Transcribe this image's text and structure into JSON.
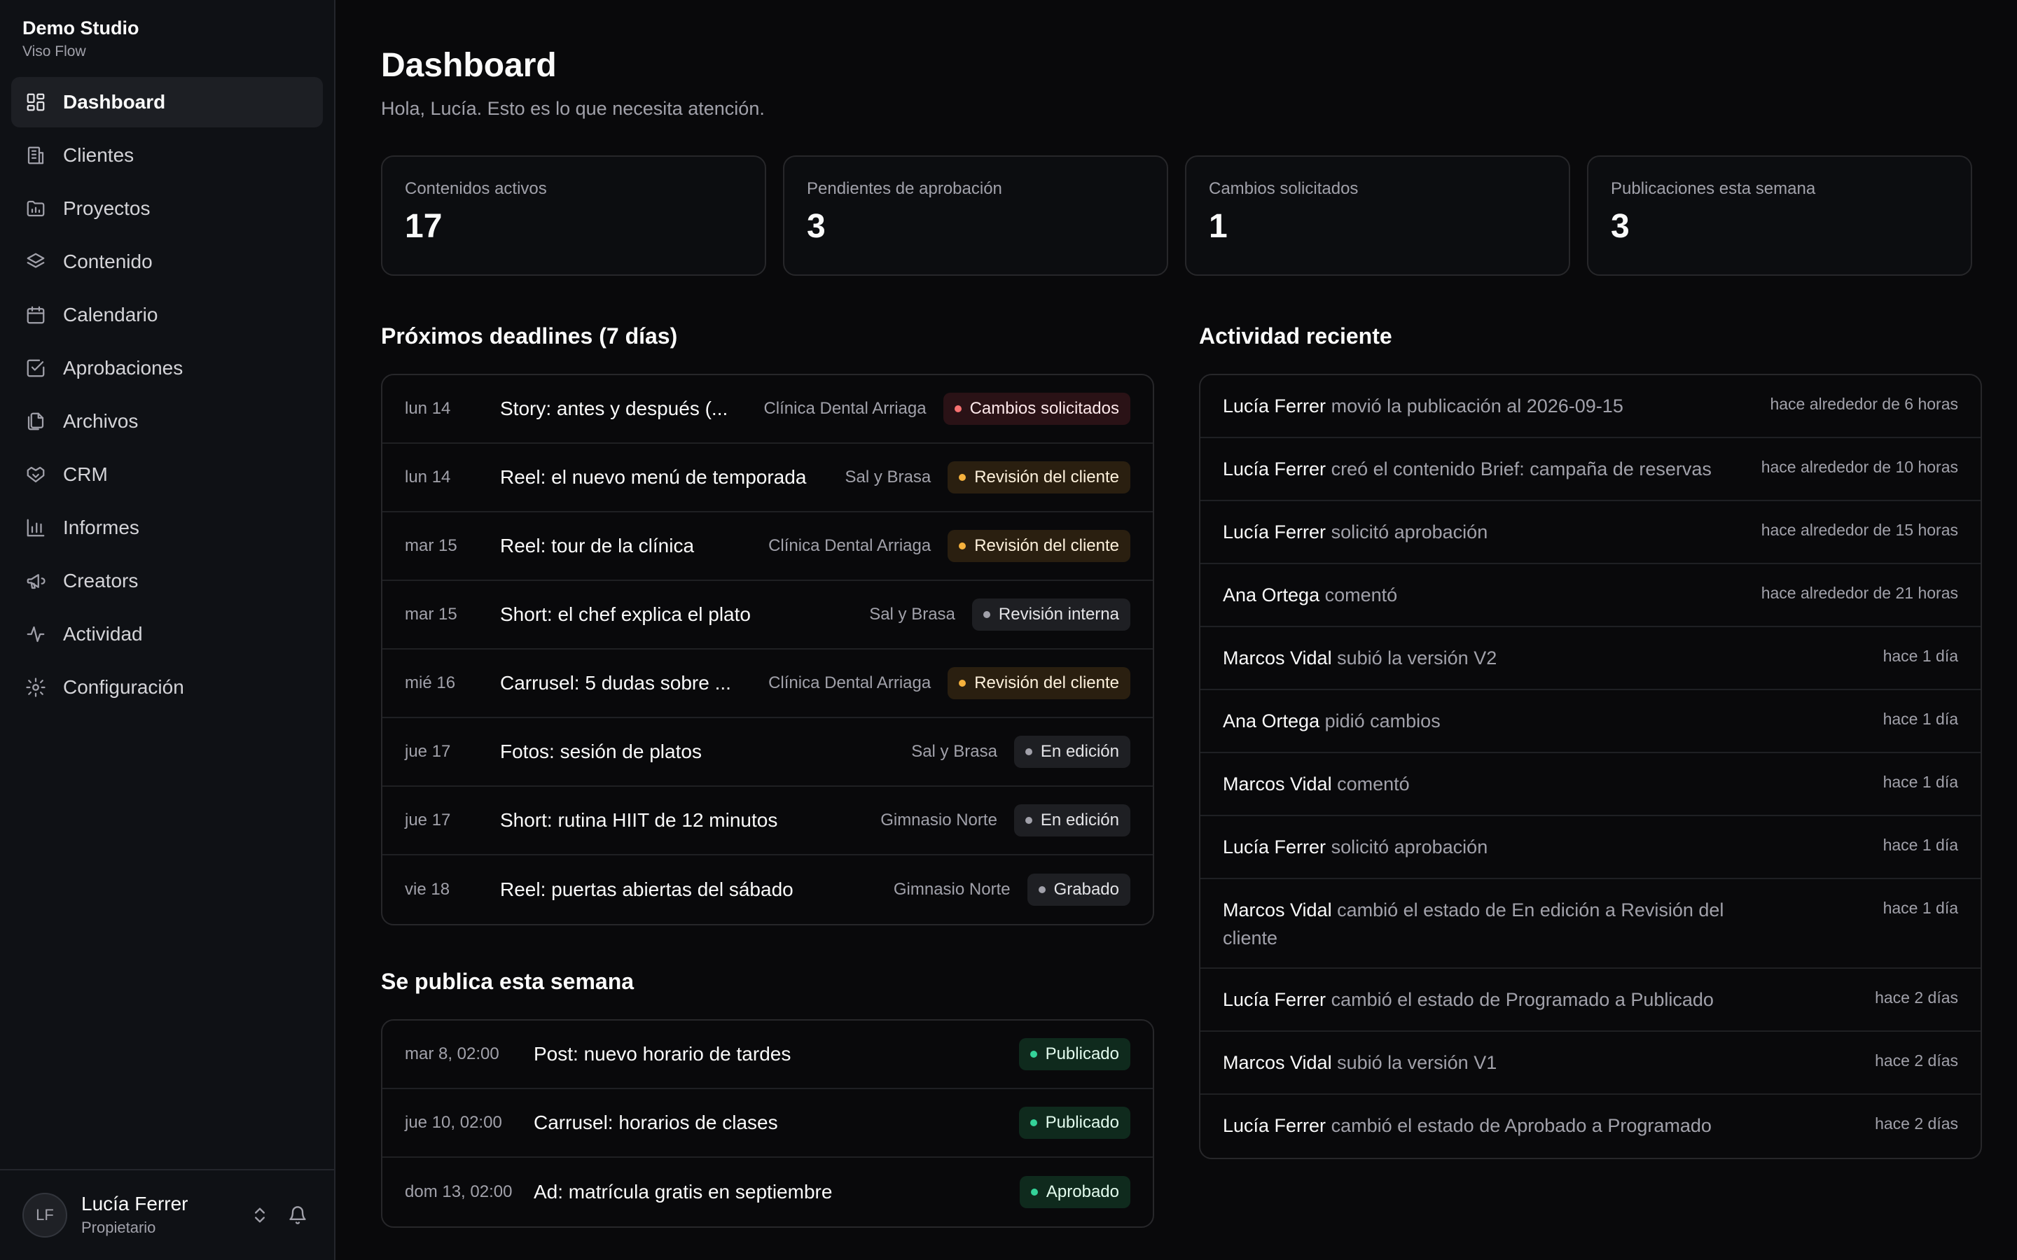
{
  "brand": {
    "name": "Demo Studio",
    "product": "Viso Flow"
  },
  "nav": [
    {
      "label": "Dashboard",
      "icon": "dashboard-icon",
      "active": true
    },
    {
      "label": "Clientes",
      "icon": "building-icon"
    },
    {
      "label": "Proyectos",
      "icon": "folder-chart-icon"
    },
    {
      "label": "Contenido",
      "icon": "layers-icon"
    },
    {
      "label": "Calendario",
      "icon": "calendar-icon"
    },
    {
      "label": "Aprobaciones",
      "icon": "check-square-icon"
    },
    {
      "label": "Archivos",
      "icon": "files-icon"
    },
    {
      "label": "CRM",
      "icon": "handshake-icon"
    },
    {
      "label": "Informes",
      "icon": "bar-chart-icon"
    },
    {
      "label": "Creators",
      "icon": "megaphone-icon"
    },
    {
      "label": "Actividad",
      "icon": "activity-icon"
    },
    {
      "label": "Configuración",
      "icon": "gear-icon"
    }
  ],
  "user": {
    "initials": "LF",
    "name": "Lucía Ferrer",
    "role": "Propietario"
  },
  "header": {
    "title": "Dashboard",
    "subtitle": "Hola, Lucía. Esto es lo que necesita atención."
  },
  "stats": [
    {
      "label": "Contenidos activos",
      "value": "17"
    },
    {
      "label": "Pendientes de aprobación",
      "value": "3"
    },
    {
      "label": "Cambios solicitados",
      "value": "1"
    },
    {
      "label": "Publicaciones esta semana",
      "value": "3"
    }
  ],
  "deadlines": {
    "title": "Próximos deadlines (7 días)",
    "rows": [
      {
        "date": "lun 14",
        "title": "Story: antes y después (...",
        "client": "Clínica Dental Arriaga",
        "status": "Cambios solicitados",
        "tone": "red"
      },
      {
        "date": "lun 14",
        "title": "Reel: el nuevo menú de temporada",
        "client": "Sal y Brasa",
        "status": "Revisión del cliente",
        "tone": "amber"
      },
      {
        "date": "mar 15",
        "title": "Reel: tour de la clínica",
        "client": "Clínica Dental Arriaga",
        "status": "Revisión del cliente",
        "tone": "amber"
      },
      {
        "date": "mar 15",
        "title": "Short: el chef explica el plato",
        "client": "Sal y Brasa",
        "status": "Revisión interna",
        "tone": "gray"
      },
      {
        "date": "mié 16",
        "title": "Carrusel: 5 dudas sobre ...",
        "client": "Clínica Dental Arriaga",
        "status": "Revisión del cliente",
        "tone": "amber"
      },
      {
        "date": "jue 17",
        "title": "Fotos: sesión de platos",
        "client": "Sal y Brasa",
        "status": "En edición",
        "tone": "gray"
      },
      {
        "date": "jue 17",
        "title": "Short: rutina HIIT de 12 minutos",
        "client": "Gimnasio Norte",
        "status": "En edición",
        "tone": "gray"
      },
      {
        "date": "vie 18",
        "title": "Reel: puertas abiertas del sábado",
        "client": "Gimnasio Norte",
        "status": "Grabado",
        "tone": "gray"
      }
    ]
  },
  "week": {
    "title": "Se publica esta semana",
    "rows": [
      {
        "date": "mar 8, 02:00",
        "title": "Post: nuevo horario de tardes",
        "status": "Publicado",
        "tone": "green"
      },
      {
        "date": "jue 10, 02:00",
        "title": "Carrusel: horarios de clases",
        "status": "Publicado",
        "tone": "green"
      },
      {
        "date": "dom 13, 02:00",
        "title": "Ad: matrícula gratis en septiembre",
        "status": "Aprobado",
        "tone": "green"
      }
    ]
  },
  "activity": {
    "title": "Actividad reciente",
    "rows": [
      {
        "actor": "Lucía Ferrer",
        "text": "movió la publicación al 2026-09-15",
        "time": "hace alrededor de 6 horas"
      },
      {
        "actor": "Lucía Ferrer",
        "text": "creó el contenido Brief: campaña de reservas",
        "time": "hace alrededor de 10 horas"
      },
      {
        "actor": "Lucía Ferrer",
        "text": "solicitó aprobación",
        "time": "hace alrededor de 15 horas"
      },
      {
        "actor": "Ana Ortega",
        "text": "comentó",
        "time": "hace alrededor de 21 horas"
      },
      {
        "actor": "Marcos Vidal",
        "text": "subió la versión V2",
        "time": "hace 1 día"
      },
      {
        "actor": "Ana Ortega",
        "text": "pidió cambios",
        "time": "hace 1 día"
      },
      {
        "actor": "Marcos Vidal",
        "text": "comentó",
        "time": "hace 1 día"
      },
      {
        "actor": "Lucía Ferrer",
        "text": "solicitó aprobación",
        "time": "hace 1 día"
      },
      {
        "actor": "Marcos Vidal",
        "text": "cambió el estado de En edición a Revisión del cliente",
        "time": "hace 1 día"
      },
      {
        "actor": "Lucía Ferrer",
        "text": "cambió el estado de Programado a Publicado",
        "time": "hace 2 días"
      },
      {
        "actor": "Marcos Vidal",
        "text": "subió la versión V1",
        "time": "hace 2 días"
      },
      {
        "actor": "Lucía Ferrer",
        "text": "cambió el estado de Aprobado a Programado",
        "time": "hace 2 días"
      }
    ]
  }
}
